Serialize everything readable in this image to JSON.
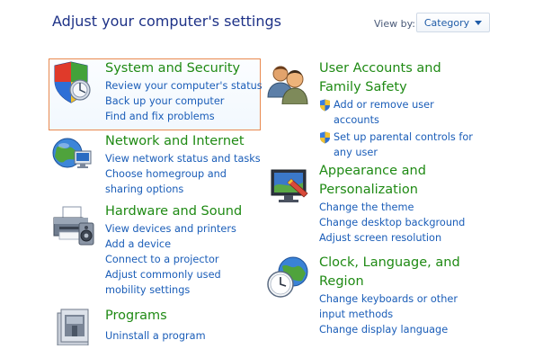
{
  "header": {
    "title": "Adjust your computer's settings",
    "view_by_label": "View by:",
    "view_by_value": "Category"
  },
  "left": [
    {
      "title": "System and Security",
      "icon": "shield-icon",
      "links": [
        "Review your computer's status",
        "Back up your computer",
        "Find and fix problems"
      ]
    },
    {
      "title": "Network and Internet",
      "icon": "network-globe-icon",
      "links": [
        "View network status and tasks",
        "Choose homegroup and",
        "sharing options"
      ]
    },
    {
      "title": "Hardware and Sound",
      "icon": "printer-icon",
      "links": [
        "View devices and printers",
        "Add a device",
        "Connect to a projector",
        "Adjust commonly used",
        "mobility settings"
      ]
    },
    {
      "title": "Programs",
      "icon": "programs-icon",
      "links": [
        "Uninstall a program"
      ]
    }
  ],
  "right": [
    {
      "title_line1": "User Accounts and",
      "title_line2": "Family Safety",
      "icon": "user-accounts-icon",
      "links": [
        "Add or remove user",
        "accounts",
        "Set up parental controls for",
        "any user"
      ]
    },
    {
      "title_line1": "Appearance and",
      "title_line2": "Personalization",
      "icon": "appearance-icon",
      "links": [
        "Change the theme",
        "Change desktop background",
        "Adjust screen resolution"
      ]
    },
    {
      "title_line1": "Clock, Language, and",
      "title_line2": "Region",
      "icon": "clock-globe-icon",
      "links": [
        "Change keyboards or other",
        "input methods",
        "Change display language"
      ]
    }
  ]
}
